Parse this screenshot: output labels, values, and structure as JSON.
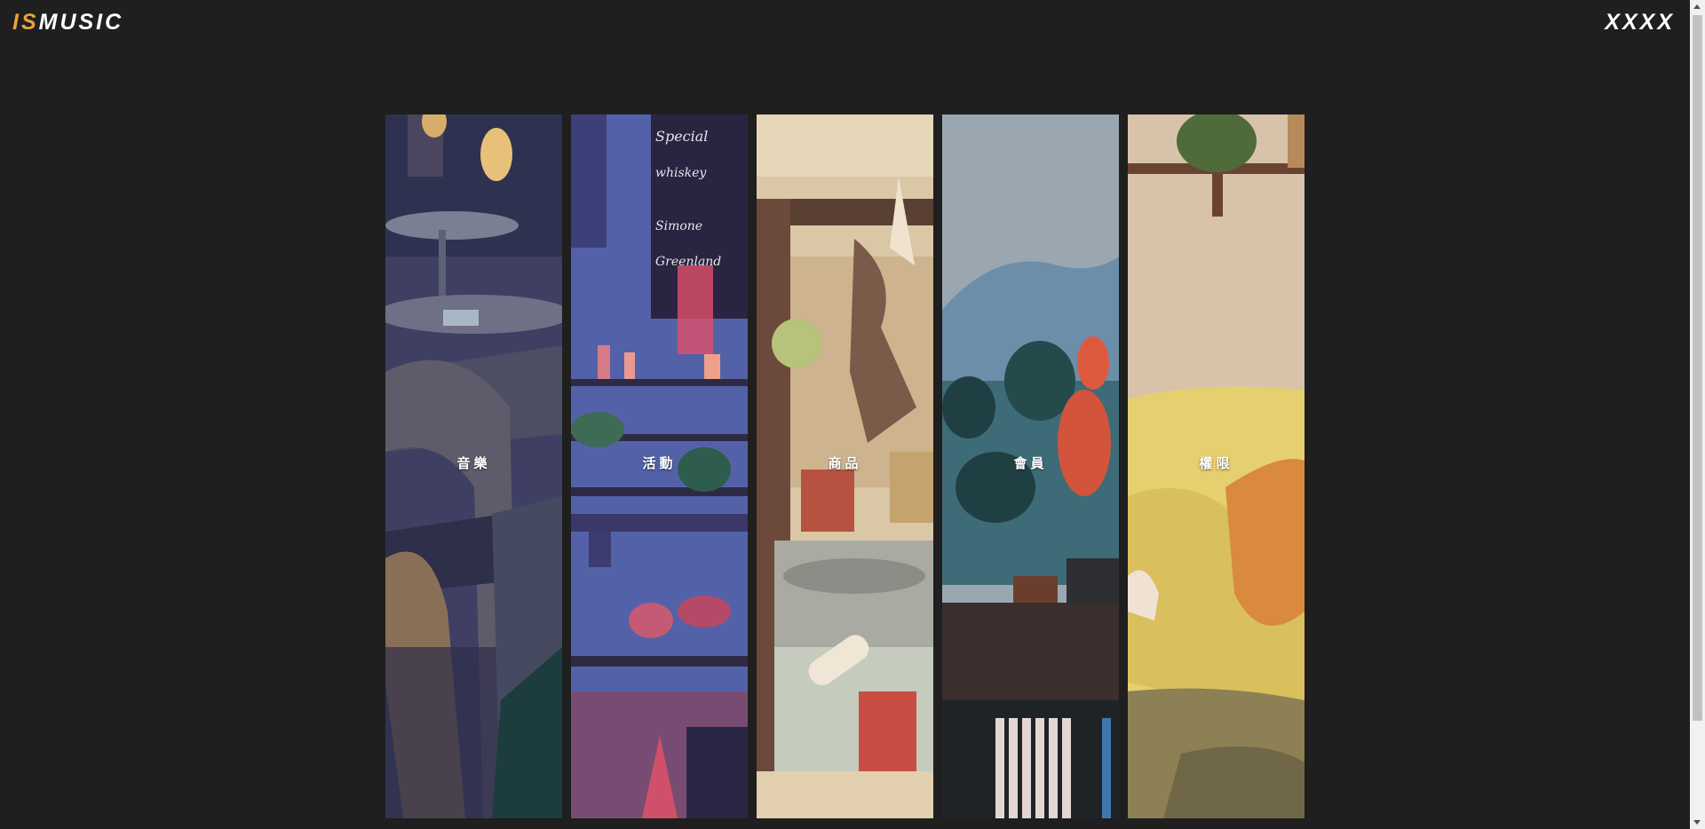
{
  "header": {
    "logo_accent": "IS",
    "logo_rest": "MUSIC",
    "user_label": "XXXX"
  },
  "colors": {
    "background": "#1f1f1f",
    "logo_accent": "#e9a23a",
    "text": "#ffffff"
  },
  "panels": [
    {
      "label": "音樂",
      "icon": "music-cafe-illustration"
    },
    {
      "label": "活動",
      "icon": "event-shelf-illustration"
    },
    {
      "label": "商品",
      "icon": "shop-freezer-illustration"
    },
    {
      "label": "會員",
      "icon": "member-plants-illustration"
    },
    {
      "label": "權限",
      "icon": "permission-sofa-illustration"
    }
  ]
}
